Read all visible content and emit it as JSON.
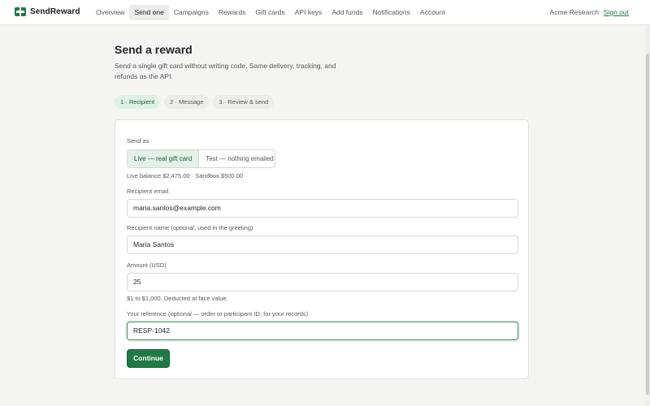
{
  "brand": {
    "name": "SendReward"
  },
  "nav": {
    "items": [
      {
        "label": "Overview",
        "active": false
      },
      {
        "label": "Send one",
        "active": true
      },
      {
        "label": "Campaigns",
        "active": false
      },
      {
        "label": "Rewards",
        "active": false
      },
      {
        "label": "Gift cards",
        "active": false
      },
      {
        "label": "API keys",
        "active": false
      },
      {
        "label": "Add funds",
        "active": false
      },
      {
        "label": "Notifications",
        "active": false
      },
      {
        "label": "Account",
        "active": false
      }
    ],
    "org_name": "Acme Research",
    "sign_out_label": "Sign out"
  },
  "page": {
    "title": "Send a reward",
    "description": "Send a single gift card without writing code. Same delivery, tracking, and refunds as the API."
  },
  "steps": [
    {
      "label": "1 · Recipient",
      "active": true
    },
    {
      "label": "2 · Message",
      "active": false
    },
    {
      "label": "3 · Review & send",
      "active": false
    }
  ],
  "form": {
    "send_as": {
      "label": "Send as",
      "options": [
        {
          "label": "Live — real gift card",
          "selected": true
        },
        {
          "label": "Test — nothing emailed",
          "selected": false
        }
      ],
      "balance_hint": "Live balance $2,475.00 · Sandbox $500.00"
    },
    "recipient_email": {
      "label": "Recipient email",
      "value": "maria.santos@example.com"
    },
    "recipient_name": {
      "label": "Recipient name (optional, used in the greeting)",
      "value": "Maria Santos"
    },
    "amount": {
      "label": "Amount (USD)",
      "value": "25",
      "hint": "$1 to $1,000. Deducted at face value."
    },
    "reference": {
      "label": "Your reference (optional — order or participant ID, for your records)",
      "value": "RESP-1042"
    },
    "continue_label": "Continue"
  },
  "colors": {
    "accent": "#1f7a45",
    "accent_light": "#e3f1e8",
    "background": "#f4f4f2"
  }
}
